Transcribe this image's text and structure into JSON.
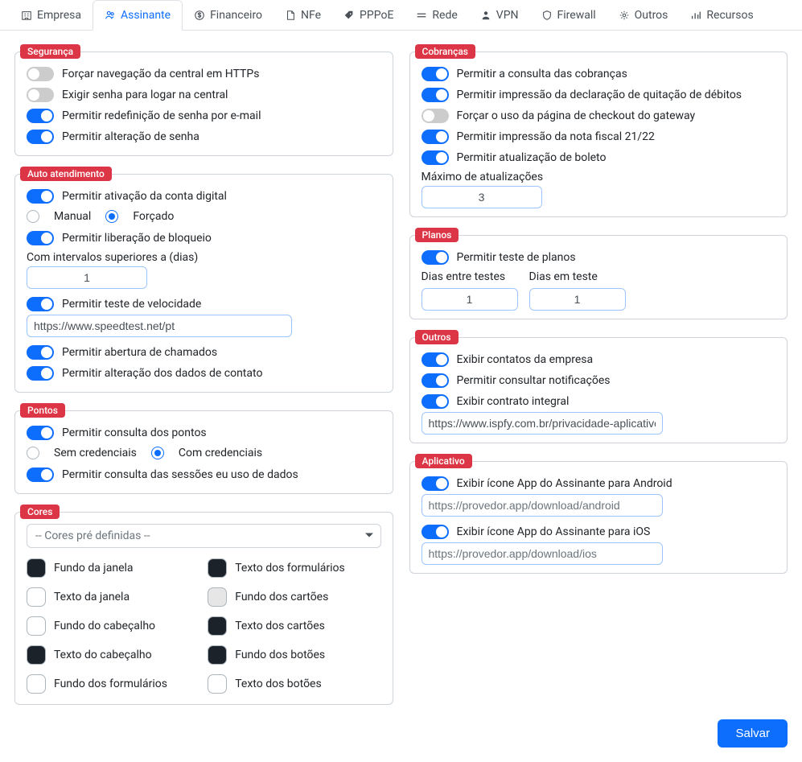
{
  "tabs": [
    {
      "label": "Empresa",
      "icon": "building"
    },
    {
      "label": "Assinante",
      "icon": "users",
      "active": true
    },
    {
      "label": "Financeiro",
      "icon": "dollar"
    },
    {
      "label": "NFe",
      "icon": "file"
    },
    {
      "label": "PPPoE",
      "icon": "tag"
    },
    {
      "label": "Rede",
      "icon": "network"
    },
    {
      "label": "VPN",
      "icon": "user"
    },
    {
      "label": "Firewall",
      "icon": "shield"
    },
    {
      "label": "Outros",
      "icon": "gear"
    },
    {
      "label": "Recursos",
      "icon": "bars"
    }
  ],
  "seguranca": {
    "title": "Segurança",
    "https": "Forçar navegação da central em HTTPs",
    "senha_logar": "Exigir senha para logar na central",
    "senha_email": "Permitir redefinição de senha por e-mail",
    "alt_senha": "Permitir alteração de senha"
  },
  "auto": {
    "title": "Auto atendimento",
    "ativacao": "Permitir ativação da conta digital",
    "manual": "Manual",
    "forcado": "Forçado",
    "liberacao": "Permitir liberação de bloqueio",
    "intervalos_lbl": "Com intervalos superiores a (dias)",
    "intervalos_val": "1",
    "teste_vel": "Permitir teste de velocidade",
    "url_speed": "https://www.speedtest.net/pt",
    "chamados": "Permitir abertura de chamados",
    "alt_contato": "Permitir alteração dos dados de contato"
  },
  "pontos": {
    "title": "Pontos",
    "consulta": "Permitir consulta dos pontos",
    "sem": "Sem credenciais",
    "com": "Com credenciais",
    "sessoes": "Permitir consulta das sessões eu uso de dados"
  },
  "cores": {
    "title": "Cores",
    "select": "-- Cores pré definidas --",
    "items": [
      {
        "label": "Fundo da janela",
        "color": "#1b2229"
      },
      {
        "label": "Texto dos formulários",
        "color": "#1b2229"
      },
      {
        "label": "Texto da janela",
        "color": "#ffffff"
      },
      {
        "label": "Fundo dos cartões",
        "color": "#e6e6e6"
      },
      {
        "label": "Fundo do cabeçalho",
        "color": "#ffffff"
      },
      {
        "label": "Texto dos cartões",
        "color": "#1b2229"
      },
      {
        "label": "Texto do cabeçalho",
        "color": "#1b2229"
      },
      {
        "label": "Fundo dos botões",
        "color": "#1b2229"
      },
      {
        "label": "Fundo dos formulários",
        "color": "#ffffff"
      },
      {
        "label": "Texto dos botões",
        "color": "#ffffff"
      }
    ]
  },
  "cobrancas": {
    "title": "Cobranças",
    "consulta": "Permitir a consulta das cobranças",
    "impressao": "Permitir impressão da declaração de quitação de débitos",
    "checkout": "Forçar o uso da página de checkout do gateway",
    "nf": "Permitir impressão da nota fiscal 21/22",
    "boleto": "Permitir atualização de boleto",
    "max_lbl": "Máximo de atualizações",
    "max_val": "3"
  },
  "planos": {
    "title": "Planos",
    "teste": "Permitir teste de planos",
    "dias_entre_lbl": "Dias entre testes",
    "dias_entre_val": "1",
    "dias_teste_lbl": "Dias em teste",
    "dias_teste_val": "1"
  },
  "outros": {
    "title": "Outros",
    "contatos": "Exibir contatos da empresa",
    "notif": "Permitir consultar notificações",
    "contrato": "Exibir contrato integral",
    "url": "https://www.ispfy.com.br/privacidade-aplicativo"
  },
  "app": {
    "title": "Aplicativo",
    "android": "Exibir ícone App do Assinante para Android",
    "android_url": "https://provedor.app/download/android",
    "ios": "Exibir ícone App do Assinante para iOS",
    "ios_url": "https://provedor.app/download/ios"
  },
  "save": "Salvar"
}
